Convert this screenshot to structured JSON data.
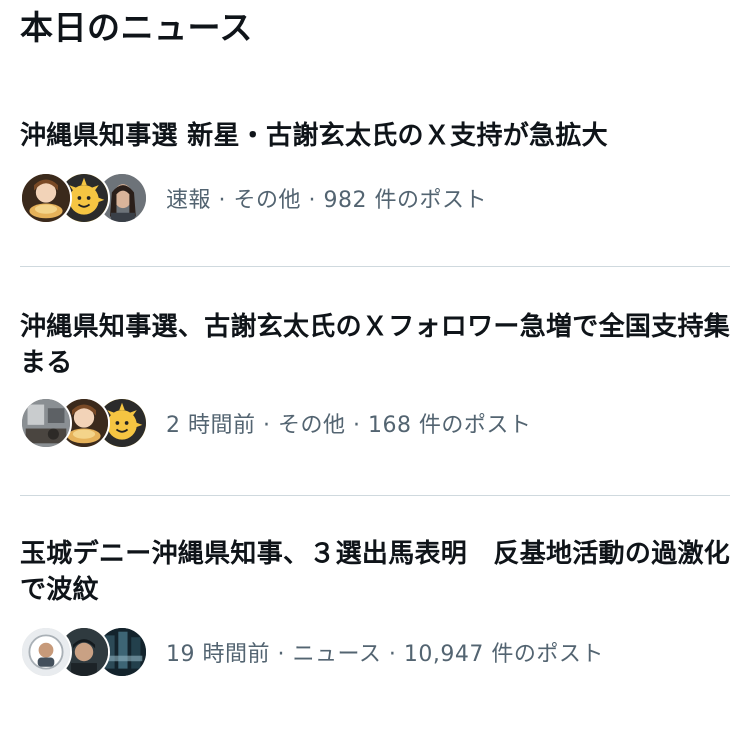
{
  "section": {
    "title": "本日のニュース"
  },
  "news": [
    {
      "headline": "沖縄県知事選 新星・古謝玄太氏のＸ支持が急拡大",
      "meta": "速報 · その他 · 982 件のポスト",
      "avatars": [
        "avatar-food-girl",
        "avatar-sun-character",
        "avatar-woman-photo"
      ]
    },
    {
      "headline": "沖縄県知事選、古謝玄太氏のＸフォロワー急増で全国支持集まる",
      "meta": "2 時間前 · その他 · 168 件のポスト",
      "avatars": [
        "avatar-room-photo",
        "avatar-food-girl",
        "avatar-sun-character"
      ]
    },
    {
      "headline": "玉城デニー沖縄県知事、３選出馬表明　反基地活動の過激化で波紋",
      "meta": "19 時間前 · ニュース · 10,947 件のポスト",
      "avatars": [
        "avatar-number-ten",
        "avatar-man-cap",
        "avatar-dark-poster"
      ]
    }
  ],
  "colors": {
    "text_primary": "#0f1419",
    "text_secondary": "#536471",
    "divider": "#cfd9de",
    "background": "#ffffff"
  }
}
